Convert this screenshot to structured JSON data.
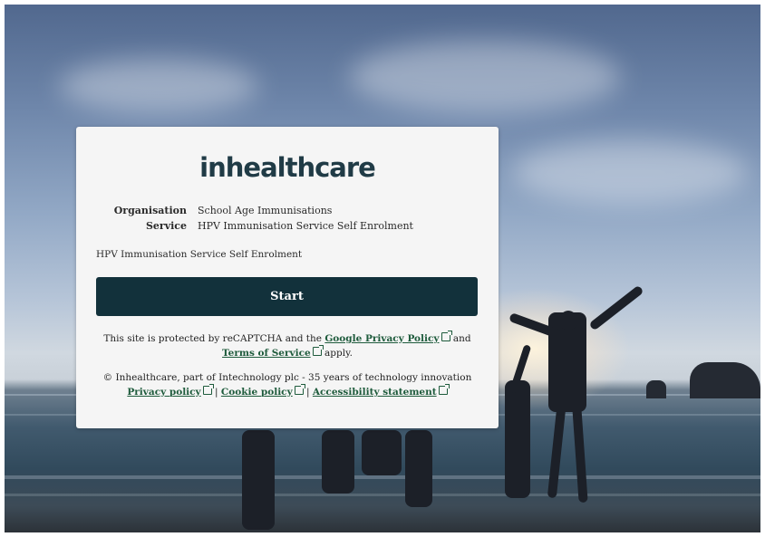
{
  "brand": {
    "logo_text": "inhealthcare",
    "link_color": "#1e5b3c",
    "button_color": "#12313b"
  },
  "details": {
    "organisation_label": "Organisation",
    "organisation_value": "School Age Immunisations",
    "service_label": "Service",
    "service_value": "HPV Immunisation Service Self Enrolment"
  },
  "description": "HPV Immunisation Service Self Enrolment",
  "start_button": "Start",
  "recaptcha": {
    "prefix": "This site is protected by reCAPTCHA and the ",
    "privacy_link": "Google Privacy Policy",
    "middle": " and ",
    "terms_link": "Terms of Service",
    "suffix": " apply."
  },
  "footer": {
    "copyright": "© Inhealthcare, part of Intechnology plc - 35 years of technology innovation",
    "links": [
      "Privacy policy",
      "Cookie policy",
      "Accessibility statement"
    ],
    "separator": " | "
  },
  "icons": {
    "external_link": "external-link-icon"
  }
}
